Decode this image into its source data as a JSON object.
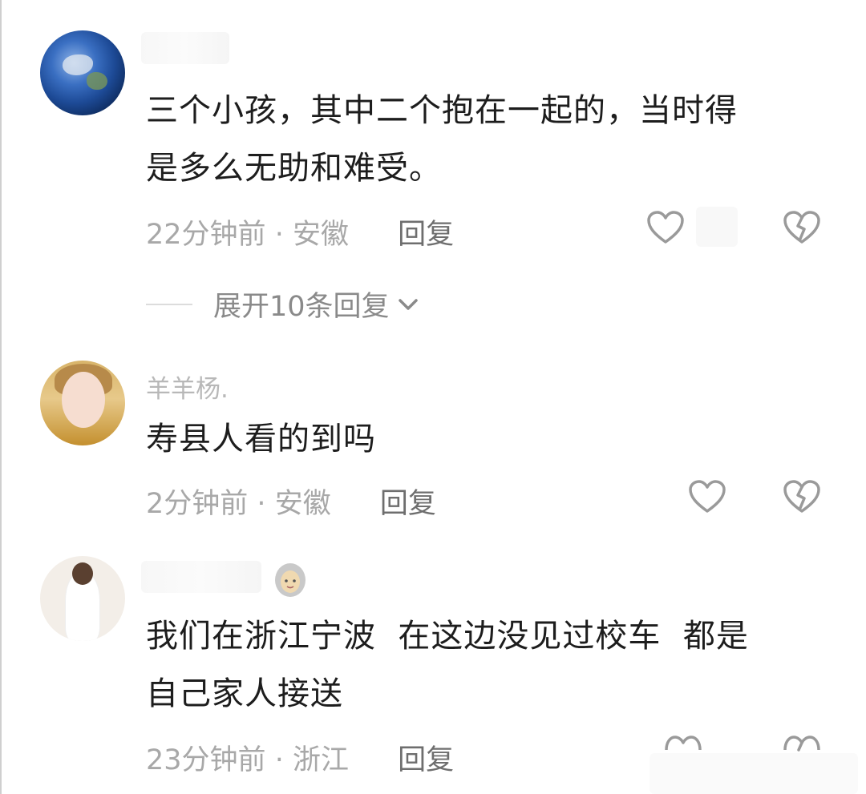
{
  "comments": [
    {
      "username": "",
      "text_lines": [
        "三个小孩，其中二个抱在一起的，当时得",
        "是多么无助和难受。"
      ],
      "time": "22分钟前",
      "sep": "·",
      "location": "安徽",
      "reply_label": "回复",
      "icons": [
        "heart-outline-icon",
        "broken-heart-icon"
      ]
    },
    {
      "username": "羊羊杨.",
      "text_lines": [
        "寿县人看的到吗"
      ],
      "time": "2分钟前",
      "sep": "·",
      "location": "安徽",
      "reply_label": "回复",
      "icons": [
        "heart-outline-icon",
        "broken-heart-icon"
      ]
    },
    {
      "username": "",
      "text_lines": [
        "我们在浙江宁波  在这边没见过校车  都是",
        "自己家人接送"
      ],
      "time": "23分钟前",
      "sep": "·",
      "location": "浙江",
      "reply_label": "回复",
      "icons": [
        "heart-outline-icon",
        "broken-heart-icon"
      ]
    }
  ],
  "expand_replies": {
    "label": "展开10条回复",
    "icon": "chevron-down-icon"
  },
  "colors": {
    "text": "#1d1d1d",
    "meta": "#a8a8a8",
    "reply": "#6e6e6e",
    "icon": "#9a9a9a"
  }
}
